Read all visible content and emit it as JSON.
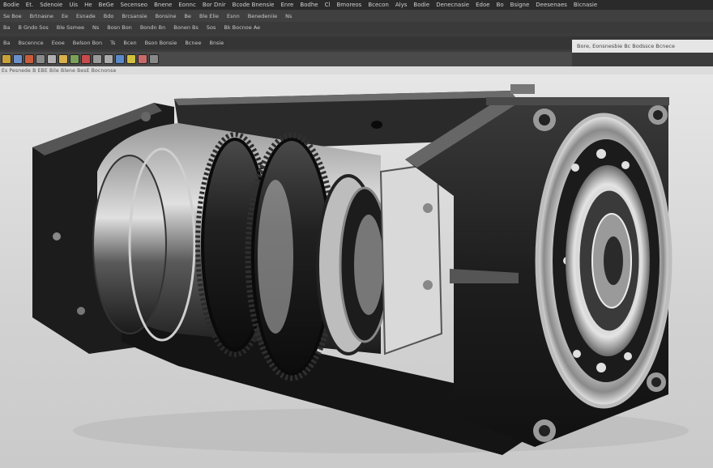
{
  "menu": {
    "items": [
      "Bodie",
      "Et.",
      "Sdenoie",
      "Uis",
      "He",
      "BeGe",
      "Secenseo",
      "Bnene",
      "Eonnc",
      "Bor Dnir",
      "Bcode Bnensie",
      "Enre",
      "Bodhe",
      "Cl",
      "Bmoreos",
      "Bcecon",
      "Alys",
      "Bodie",
      "Denecnasie",
      "Edoe",
      "Bo",
      "Bsigne",
      "Deesenaes",
      "Bicnasie"
    ]
  },
  "toolbar": {
    "row1": [
      "Se Boe",
      "Brtnasne",
      "Ee",
      "Esnade",
      "Bdo",
      "Brcsansie",
      "Bonsine",
      "Be",
      "Ble Elie",
      "Esnn",
      "Benedeniie",
      "Ns"
    ],
    "row2": [
      "Ba",
      "B  Gndo Sos",
      "Ble Ssmee",
      "Ns",
      "Bosn Bon",
      "Bondn Bn",
      "Bonen Bs",
      "Sos",
      "Bk Bocnoe Ae"
    ],
    "row3": [
      "Ba",
      "Bscennce",
      "Eooe",
      "Belson Bon",
      "Ts",
      "Bcen",
      "Bson Bonsie",
      "Bcnee",
      "Bnsie"
    ]
  },
  "status": {
    "text": "Bore,  Eonsnesbie  Bc  Bodssce  Bcnece"
  },
  "path": {
    "text": "Es Pesnede B EBE Bile Blene BesE Bocnonse"
  },
  "colors": {
    "ribbon": "#3c3c3c",
    "background": "#d8d8d8",
    "metal_dark": "#2b2b2b",
    "metal_light": "#c9c9c9"
  },
  "icons": [
    "folder-icon",
    "save-icon",
    "image-icon",
    "document-icon",
    "settings-icon",
    "grid-icon",
    "view-icon",
    "render-icon",
    "camera-icon",
    "lock-icon",
    "layer-icon",
    "star-icon",
    "target-icon",
    "palette-icon"
  ]
}
